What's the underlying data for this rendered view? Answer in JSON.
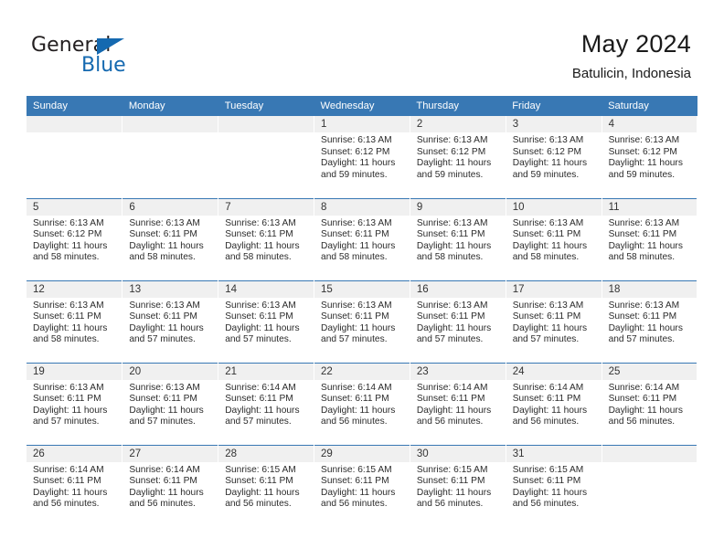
{
  "logo": {
    "word_top": "General",
    "word_bottom": "Blue",
    "triangle_icon": "triangle-icon",
    "brand_color": "#1569b0",
    "text_color": "#231f20"
  },
  "header": {
    "title": "May 2024",
    "subtitle": "Batulicin, Indonesia"
  },
  "theme": {
    "header_bg": "#3878b4",
    "header_text": "#ffffff",
    "daynum_band_bg": "#f0f0f0",
    "cell_bg": "#ffffff",
    "row_divider": "#3878b4"
  },
  "weekdays": [
    "Sunday",
    "Monday",
    "Tuesday",
    "Wednesday",
    "Thursday",
    "Friday",
    "Saturday"
  ],
  "labels": {
    "sunrise_prefix": "Sunrise: ",
    "sunset_prefix": "Sunset: ",
    "daylight_prefix": "Daylight: "
  },
  "weeks": [
    [
      {
        "empty": true
      },
      {
        "empty": true
      },
      {
        "empty": true
      },
      {
        "day": "1",
        "sunrise": "Sunrise: 6:13 AM",
        "sunset": "Sunset: 6:12 PM",
        "daylight_l1": "Daylight: 11 hours",
        "daylight_l2": "and 59 minutes."
      },
      {
        "day": "2",
        "sunrise": "Sunrise: 6:13 AM",
        "sunset": "Sunset: 6:12 PM",
        "daylight_l1": "Daylight: 11 hours",
        "daylight_l2": "and 59 minutes."
      },
      {
        "day": "3",
        "sunrise": "Sunrise: 6:13 AM",
        "sunset": "Sunset: 6:12 PM",
        "daylight_l1": "Daylight: 11 hours",
        "daylight_l2": "and 59 minutes."
      },
      {
        "day": "4",
        "sunrise": "Sunrise: 6:13 AM",
        "sunset": "Sunset: 6:12 PM",
        "daylight_l1": "Daylight: 11 hours",
        "daylight_l2": "and 59 minutes."
      }
    ],
    [
      {
        "day": "5",
        "sunrise": "Sunrise: 6:13 AM",
        "sunset": "Sunset: 6:12 PM",
        "daylight_l1": "Daylight: 11 hours",
        "daylight_l2": "and 58 minutes."
      },
      {
        "day": "6",
        "sunrise": "Sunrise: 6:13 AM",
        "sunset": "Sunset: 6:11 PM",
        "daylight_l1": "Daylight: 11 hours",
        "daylight_l2": "and 58 minutes."
      },
      {
        "day": "7",
        "sunrise": "Sunrise: 6:13 AM",
        "sunset": "Sunset: 6:11 PM",
        "daylight_l1": "Daylight: 11 hours",
        "daylight_l2": "and 58 minutes."
      },
      {
        "day": "8",
        "sunrise": "Sunrise: 6:13 AM",
        "sunset": "Sunset: 6:11 PM",
        "daylight_l1": "Daylight: 11 hours",
        "daylight_l2": "and 58 minutes."
      },
      {
        "day": "9",
        "sunrise": "Sunrise: 6:13 AM",
        "sunset": "Sunset: 6:11 PM",
        "daylight_l1": "Daylight: 11 hours",
        "daylight_l2": "and 58 minutes."
      },
      {
        "day": "10",
        "sunrise": "Sunrise: 6:13 AM",
        "sunset": "Sunset: 6:11 PM",
        "daylight_l1": "Daylight: 11 hours",
        "daylight_l2": "and 58 minutes."
      },
      {
        "day": "11",
        "sunrise": "Sunrise: 6:13 AM",
        "sunset": "Sunset: 6:11 PM",
        "daylight_l1": "Daylight: 11 hours",
        "daylight_l2": "and 58 minutes."
      }
    ],
    [
      {
        "day": "12",
        "sunrise": "Sunrise: 6:13 AM",
        "sunset": "Sunset: 6:11 PM",
        "daylight_l1": "Daylight: 11 hours",
        "daylight_l2": "and 58 minutes."
      },
      {
        "day": "13",
        "sunrise": "Sunrise: 6:13 AM",
        "sunset": "Sunset: 6:11 PM",
        "daylight_l1": "Daylight: 11 hours",
        "daylight_l2": "and 57 minutes."
      },
      {
        "day": "14",
        "sunrise": "Sunrise: 6:13 AM",
        "sunset": "Sunset: 6:11 PM",
        "daylight_l1": "Daylight: 11 hours",
        "daylight_l2": "and 57 minutes."
      },
      {
        "day": "15",
        "sunrise": "Sunrise: 6:13 AM",
        "sunset": "Sunset: 6:11 PM",
        "daylight_l1": "Daylight: 11 hours",
        "daylight_l2": "and 57 minutes."
      },
      {
        "day": "16",
        "sunrise": "Sunrise: 6:13 AM",
        "sunset": "Sunset: 6:11 PM",
        "daylight_l1": "Daylight: 11 hours",
        "daylight_l2": "and 57 minutes."
      },
      {
        "day": "17",
        "sunrise": "Sunrise: 6:13 AM",
        "sunset": "Sunset: 6:11 PM",
        "daylight_l1": "Daylight: 11 hours",
        "daylight_l2": "and 57 minutes."
      },
      {
        "day": "18",
        "sunrise": "Sunrise: 6:13 AM",
        "sunset": "Sunset: 6:11 PM",
        "daylight_l1": "Daylight: 11 hours",
        "daylight_l2": "and 57 minutes."
      }
    ],
    [
      {
        "day": "19",
        "sunrise": "Sunrise: 6:13 AM",
        "sunset": "Sunset: 6:11 PM",
        "daylight_l1": "Daylight: 11 hours",
        "daylight_l2": "and 57 minutes."
      },
      {
        "day": "20",
        "sunrise": "Sunrise: 6:13 AM",
        "sunset": "Sunset: 6:11 PM",
        "daylight_l1": "Daylight: 11 hours",
        "daylight_l2": "and 57 minutes."
      },
      {
        "day": "21",
        "sunrise": "Sunrise: 6:14 AM",
        "sunset": "Sunset: 6:11 PM",
        "daylight_l1": "Daylight: 11 hours",
        "daylight_l2": "and 57 minutes."
      },
      {
        "day": "22",
        "sunrise": "Sunrise: 6:14 AM",
        "sunset": "Sunset: 6:11 PM",
        "daylight_l1": "Daylight: 11 hours",
        "daylight_l2": "and 56 minutes."
      },
      {
        "day": "23",
        "sunrise": "Sunrise: 6:14 AM",
        "sunset": "Sunset: 6:11 PM",
        "daylight_l1": "Daylight: 11 hours",
        "daylight_l2": "and 56 minutes."
      },
      {
        "day": "24",
        "sunrise": "Sunrise: 6:14 AM",
        "sunset": "Sunset: 6:11 PM",
        "daylight_l1": "Daylight: 11 hours",
        "daylight_l2": "and 56 minutes."
      },
      {
        "day": "25",
        "sunrise": "Sunrise: 6:14 AM",
        "sunset": "Sunset: 6:11 PM",
        "daylight_l1": "Daylight: 11 hours",
        "daylight_l2": "and 56 minutes."
      }
    ],
    [
      {
        "day": "26",
        "sunrise": "Sunrise: 6:14 AM",
        "sunset": "Sunset: 6:11 PM",
        "daylight_l1": "Daylight: 11 hours",
        "daylight_l2": "and 56 minutes."
      },
      {
        "day": "27",
        "sunrise": "Sunrise: 6:14 AM",
        "sunset": "Sunset: 6:11 PM",
        "daylight_l1": "Daylight: 11 hours",
        "daylight_l2": "and 56 minutes."
      },
      {
        "day": "28",
        "sunrise": "Sunrise: 6:15 AM",
        "sunset": "Sunset: 6:11 PM",
        "daylight_l1": "Daylight: 11 hours",
        "daylight_l2": "and 56 minutes."
      },
      {
        "day": "29",
        "sunrise": "Sunrise: 6:15 AM",
        "sunset": "Sunset: 6:11 PM",
        "daylight_l1": "Daylight: 11 hours",
        "daylight_l2": "and 56 minutes."
      },
      {
        "day": "30",
        "sunrise": "Sunrise: 6:15 AM",
        "sunset": "Sunset: 6:11 PM",
        "daylight_l1": "Daylight: 11 hours",
        "daylight_l2": "and 56 minutes."
      },
      {
        "day": "31",
        "sunrise": "Sunrise: 6:15 AM",
        "sunset": "Sunset: 6:11 PM",
        "daylight_l1": "Daylight: 11 hours",
        "daylight_l2": "and 56 minutes."
      },
      {
        "empty": true
      }
    ]
  ]
}
